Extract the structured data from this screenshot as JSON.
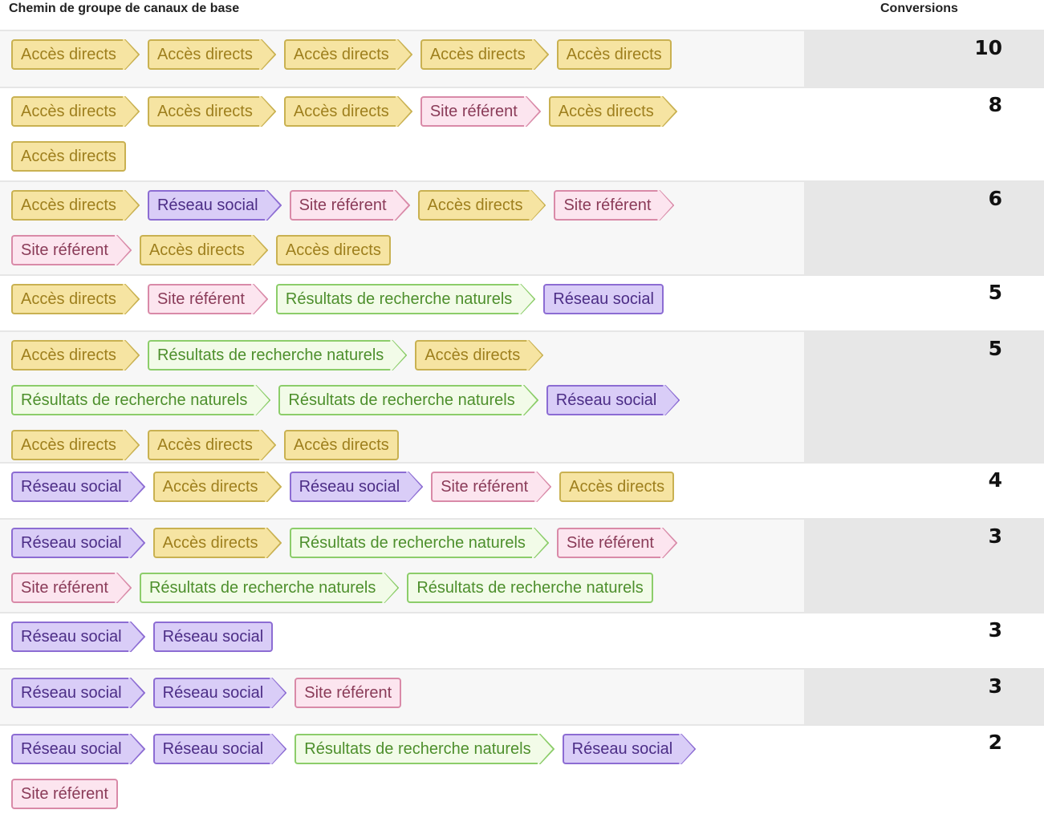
{
  "header": {
    "path_column": "Chemin de groupe de canaux de base",
    "conversions_column": "Conversions"
  },
  "channel_colors": {
    "direct": "#f6e4a2",
    "social": "#d9cdf7",
    "referral": "#fce5ef",
    "organic": "#f2fbe8"
  },
  "rows": [
    {
      "conversions": "10",
      "path": [
        {
          "type": "direct",
          "label": "Accès directs"
        },
        {
          "type": "direct",
          "label": "Accès directs"
        },
        {
          "type": "direct",
          "label": "Accès directs"
        },
        {
          "type": "direct",
          "label": "Accès directs"
        },
        {
          "type": "direct",
          "label": "Accès directs"
        }
      ]
    },
    {
      "conversions": "8",
      "path": [
        {
          "type": "direct",
          "label": "Accès directs"
        },
        {
          "type": "direct",
          "label": "Accès directs"
        },
        {
          "type": "direct",
          "label": "Accès directs"
        },
        {
          "type": "referral",
          "label": "Site référent"
        },
        {
          "type": "direct",
          "label": "Accès directs"
        },
        {
          "type": "direct",
          "label": "Accès directs"
        }
      ]
    },
    {
      "conversions": "6",
      "path": [
        {
          "type": "direct",
          "label": "Accès directs"
        },
        {
          "type": "social",
          "label": "Réseau social"
        },
        {
          "type": "referral",
          "label": "Site référent"
        },
        {
          "type": "direct",
          "label": "Accès directs"
        },
        {
          "type": "referral",
          "label": "Site référent"
        },
        {
          "type": "referral",
          "label": "Site référent"
        },
        {
          "type": "direct",
          "label": "Accès directs"
        },
        {
          "type": "direct",
          "label": "Accès directs"
        }
      ]
    },
    {
      "conversions": "5",
      "path": [
        {
          "type": "direct",
          "label": "Accès directs"
        },
        {
          "type": "referral",
          "label": "Site référent"
        },
        {
          "type": "organic",
          "label": "Résultats de recherche naturels"
        },
        {
          "type": "social",
          "label": "Réseau social"
        }
      ]
    },
    {
      "conversions": "5",
      "path": [
        {
          "type": "direct",
          "label": "Accès directs"
        },
        {
          "type": "organic",
          "label": "Résultats de recherche naturels"
        },
        {
          "type": "direct",
          "label": "Accès directs"
        },
        {
          "type": "organic",
          "label": "Résultats de recherche naturels"
        },
        {
          "type": "organic",
          "label": "Résultats de recherche naturels"
        },
        {
          "type": "social",
          "label": "Réseau social"
        },
        {
          "type": "direct",
          "label": "Accès directs"
        },
        {
          "type": "direct",
          "label": "Accès directs"
        },
        {
          "type": "direct",
          "label": "Accès directs"
        }
      ]
    },
    {
      "conversions": "4",
      "path": [
        {
          "type": "social",
          "label": "Réseau social"
        },
        {
          "type": "direct",
          "label": "Accès directs"
        },
        {
          "type": "social",
          "label": "Réseau social"
        },
        {
          "type": "referral",
          "label": "Site référent"
        },
        {
          "type": "direct",
          "label": "Accès directs"
        }
      ]
    },
    {
      "conversions": "3",
      "path": [
        {
          "type": "social",
          "label": "Réseau social"
        },
        {
          "type": "direct",
          "label": "Accès directs"
        },
        {
          "type": "organic",
          "label": "Résultats de recherche naturels"
        },
        {
          "type": "referral",
          "label": "Site référent"
        },
        {
          "type": "referral",
          "label": "Site référent"
        },
        {
          "type": "organic",
          "label": "Résultats de recherche naturels"
        },
        {
          "type": "organic",
          "label": "Résultats de recherche naturels"
        }
      ]
    },
    {
      "conversions": "3",
      "path": [
        {
          "type": "social",
          "label": "Réseau social"
        },
        {
          "type": "social",
          "label": "Réseau social"
        }
      ]
    },
    {
      "conversions": "3",
      "path": [
        {
          "type": "social",
          "label": "Réseau social"
        },
        {
          "type": "social",
          "label": "Réseau social"
        },
        {
          "type": "referral",
          "label": "Site référent"
        }
      ]
    },
    {
      "conversions": "2",
      "path": [
        {
          "type": "social",
          "label": "Réseau social"
        },
        {
          "type": "social",
          "label": "Réseau social"
        },
        {
          "type": "organic",
          "label": "Résultats de recherche naturels"
        },
        {
          "type": "social",
          "label": "Réseau social"
        },
        {
          "type": "referral",
          "label": "Site référent"
        }
      ]
    }
  ]
}
